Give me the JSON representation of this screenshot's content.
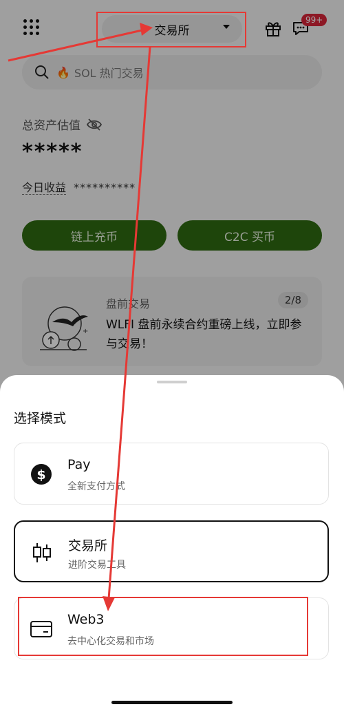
{
  "header": {
    "mode_label": "交易所",
    "badge": "99+"
  },
  "search": {
    "placeholder": "SOL 热门交易"
  },
  "assets": {
    "label": "总资产估值",
    "value": "*****",
    "pnl_label": "今日收益",
    "pnl_value": "**********"
  },
  "actions": {
    "deposit": "链上充币",
    "c2c": "C2C 买币"
  },
  "banner": {
    "category": "盘前交易",
    "page": "2/8",
    "text": "WLFI 盘前永续合约重磅上线，立即参与交易！"
  },
  "sheet": {
    "title": "选择模式",
    "options": [
      {
        "name": "Pay",
        "desc": "全新支付方式",
        "icon": "dollar-circle-icon"
      },
      {
        "name": "交易所",
        "desc": "进阶交易工具",
        "icon": "candlestick-icon"
      },
      {
        "name": "Web3",
        "desc": "去中心化交易和市场",
        "icon": "wallet-icon"
      }
    ]
  },
  "colors": {
    "accent_green": "#2f6a12",
    "annotation_red": "#e53935",
    "badge_red": "#d9263a"
  }
}
